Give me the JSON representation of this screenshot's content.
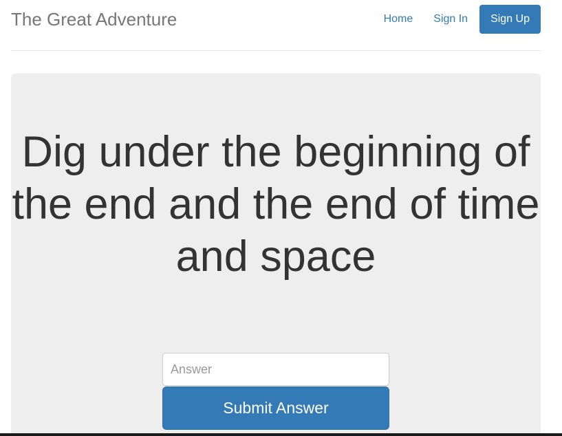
{
  "header": {
    "brand": "The Great Adventure",
    "nav": {
      "home": "Home",
      "sign_in": "Sign In",
      "sign_up": "Sign Up"
    }
  },
  "main": {
    "riddle": "Dig under the beginning of the end and the end of time and space",
    "answer_placeholder": "Answer",
    "submit_label": "Submit Answer"
  },
  "colors": {
    "accent": "#337ab7",
    "jumbotron_bg": "#eeeeee",
    "text": "#333333",
    "brand_text": "#777777"
  }
}
